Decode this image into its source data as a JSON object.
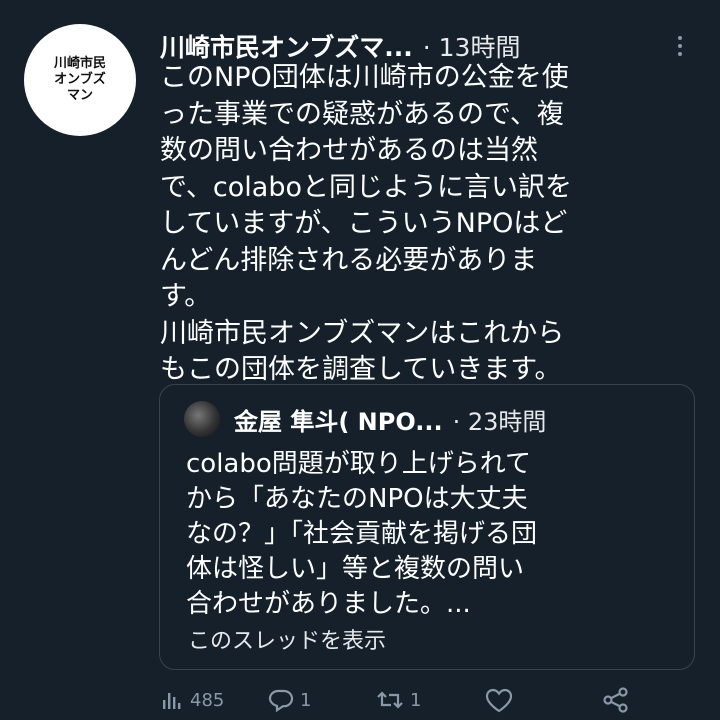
{
  "tweet": {
    "avatar_lines": [
      "川崎市民",
      "オンブズ",
      "マン"
    ],
    "author": "川崎市民オンブズマ...",
    "meta": "· 13時間",
    "text": "このNPO団体は川崎市の公金を使\nった事業での疑惑があるので、複\n数の問い合わせがあるのは当然\nで、colaboと同じように言い訳を\nしていますが、こういうNPOはど\nんどん排除される必要がありま\nす。\n川崎市民オンブズマンはこれから\nもこの団体を調査していきます。"
  },
  "quote": {
    "author": "金屋 隼斗( NPO...",
    "meta": "· 23時間",
    "text": "colabo問題が取り上げられて\nから「あなたのNPOは大丈夫\nなの？」「社会貢献を掲げる団\n体は怪しい」等と複数の問い\n合わせがありました。...",
    "thread_link": "このスレッドを表示"
  },
  "actions": {
    "views": "485",
    "replies": "1",
    "retweets": "1"
  },
  "icons": [
    "more-icon",
    "views-icon",
    "reply-icon",
    "retweet-icon",
    "like-icon",
    "share-icon"
  ],
  "colors": {
    "background": "#15202b",
    "text": "#e7e9ea",
    "muted": "#8b98a5",
    "border": "#38444d"
  }
}
